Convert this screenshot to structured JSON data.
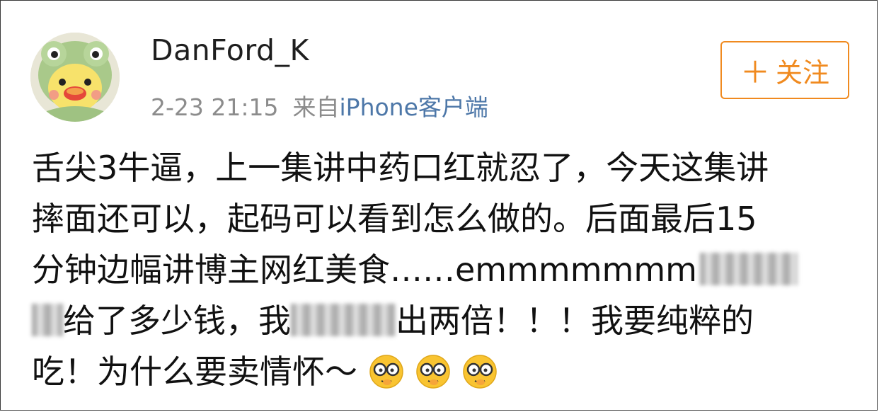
{
  "user": {
    "name": "DanFord_K",
    "timestamp": "2-23 21:15",
    "source_prefix": "来自",
    "source_client": "iPhone客户端"
  },
  "follow_button": {
    "icon": "plus-icon",
    "label": "关注",
    "color": "#f08a1f"
  },
  "post": {
    "line1": "舌尖3牛逼，上一集讲中药口红就忍了，今天这集讲",
    "line2": "摔面还可以，起码可以看到怎么做的。后面最后15",
    "line3": "分钟边幅讲博主网红美食……emmmmmmm",
    "line4_a": "给了多少钱，我",
    "line4_b": "出两倍！！！我要纯粹的",
    "line5": "吃！为什么要卖情怀～",
    "emojis": [
      "nerd-glasses-emoji",
      "nerd-glasses-emoji",
      "nerd-glasses-emoji"
    ]
  },
  "colors": {
    "link": "#4d77a8",
    "meta": "#8c8c8c",
    "text": "#111111"
  }
}
